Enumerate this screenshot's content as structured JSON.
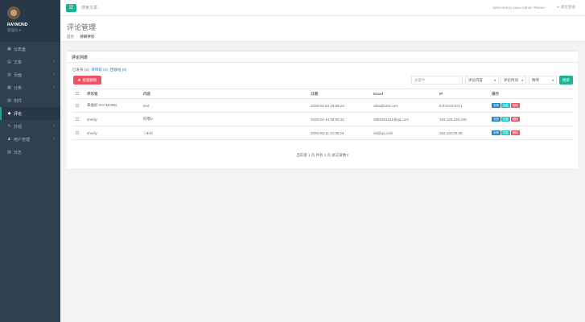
{
  "sidebar": {
    "user_name": "RAYMOND",
    "user_role": "管理员 ▾",
    "items": [
      {
        "label": "仪表盘",
        "icon": "dashboard-icon",
        "glyph": "▣",
        "arrow": ""
      },
      {
        "label": "文章",
        "icon": "article-icon",
        "glyph": "▤",
        "arrow": "‹"
      },
      {
        "label": "页面",
        "icon": "page-icon",
        "glyph": "▥",
        "arrow": "‹"
      },
      {
        "label": "分类",
        "icon": "category-icon",
        "glyph": "▦",
        "arrow": "‹"
      },
      {
        "label": "附件",
        "icon": "attachment-icon",
        "glyph": "▧",
        "arrow": ""
      },
      {
        "label": "评论",
        "icon": "comment-icon",
        "glyph": "◆",
        "arrow": ""
      },
      {
        "label": "外观",
        "icon": "appearance-icon",
        "glyph": "✎",
        "arrow": "‹"
      },
      {
        "label": "用户管理",
        "icon": "user-icon",
        "glyph": "♟",
        "arrow": "‹"
      },
      {
        "label": "日志",
        "icon": "log-icon",
        "glyph": "▨",
        "arrow": ""
      }
    ]
  },
  "topbar": {
    "menu_glyph": "☰",
    "search_placeholder": "搜索文章...",
    "welcome": "Welcome to sxLiu Admin Theme.",
    "logout": "退出登录",
    "logout_glyph": "⇥"
  },
  "heading": {
    "title": "评论管理",
    "crumb_home": "首页",
    "crumb_sep": "/",
    "crumb_current": "待审评论"
  },
  "panel": {
    "title": "评论列表",
    "filter_published": "已发布 (3)",
    "filter_pending": "待审核 (0)",
    "filter_trash": "回收站 (0)",
    "filter_bar": "|",
    "batch_delete": "批量删除",
    "batch_glyph": "✖",
    "keyword_placeholder": "关键字",
    "select_content": "评论内容",
    "select_time": "评论时间",
    "select_order": "降序",
    "caret": "▾",
    "search_button": "搜索",
    "pager": "当前第 1 页,共有 1 页,总记录数3"
  },
  "table": {
    "headers": [
      "评论者",
      "内容",
      "日期",
      "Email",
      "IP",
      "操作"
    ],
    "rows": [
      {
        "author": "黄雅如 RAYMOND",
        "content": "test",
        "date": "2020-04-24 19:56:23",
        "email": "oilcx@163.com",
        "ip": "0:0:0:0:0:0:0:1"
      },
      {
        "author": "shmily",
        "content": "的哦V",
        "date": "2020-04-14 09:55:42",
        "email": "2681561311@qq.com",
        "ip": "182.120.236.245"
      },
      {
        "author": "shmily",
        "content": "`l.lk:kl",
        "date": "2020-04-11 12:35:24",
        "email": "26@qq.com",
        "ip": "182.110.30.38"
      }
    ],
    "op_view": "查看",
    "op_edit": "回复",
    "op_delete": "删除"
  }
}
